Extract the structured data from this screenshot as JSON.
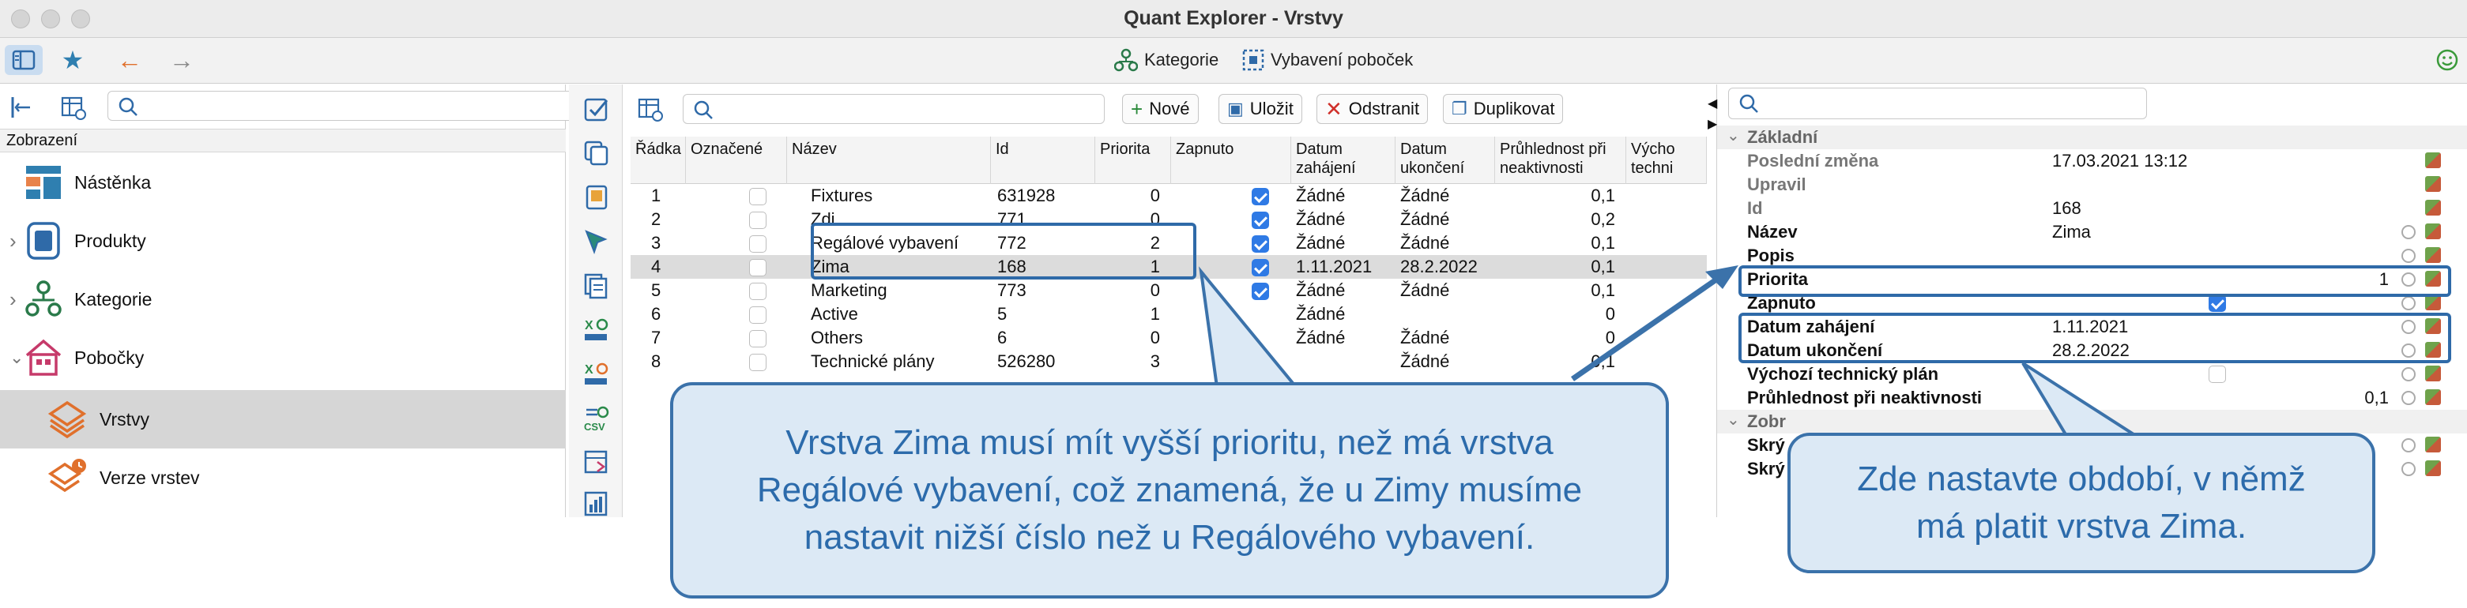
{
  "window": {
    "title": "Quant Explorer - Vrstvy"
  },
  "toolbar": {
    "categories_label": "Kategorie",
    "branch_equipment_label": "Vybavení poboček"
  },
  "left_panel": {
    "section_label": "Zobrazení",
    "items": [
      {
        "label": "Nástěnka"
      },
      {
        "label": "Produkty"
      },
      {
        "label": "Kategorie"
      },
      {
        "label": "Pobočky"
      },
      {
        "label": "Vrstvy"
      },
      {
        "label": "Verze vrstev"
      }
    ]
  },
  "actions": {
    "new": "Nové",
    "save": "Uložit",
    "delete": "Odstranit",
    "duplicate": "Duplikovat"
  },
  "table": {
    "columns": [
      "Řádka",
      "Označené",
      "Název",
      "Id",
      "Priorita",
      "Zapnuto",
      "Datum zahájení",
      "Datum ukončení",
      "Průhlednost při neaktivnosti",
      "Výcho techni"
    ],
    "rows": [
      {
        "row": "1",
        "name": "Fixtures",
        "id": "631928",
        "priority": "0",
        "start": "Žádné",
        "end": "Žádné",
        "transparency": "0,1"
      },
      {
        "row": "2",
        "name": "Zdi",
        "id": "771",
        "priority": "0",
        "start": "Žádné",
        "end": "Žádné",
        "transparency": "0,2"
      },
      {
        "row": "3",
        "name": "Regálové vybavení",
        "id": "772",
        "priority": "2",
        "start": "Žádné",
        "end": "Žádné",
        "transparency": "0,1"
      },
      {
        "row": "4",
        "name": "Zima",
        "id": "168",
        "priority": "1",
        "start": "1.11.2021",
        "end": "28.2.2022",
        "transparency": "0,1"
      },
      {
        "row": "5",
        "name": "Marketing",
        "id": "773",
        "priority": "0",
        "start": "Žádné",
        "end": "Žádné",
        "transparency": "0,1"
      },
      {
        "row": "6",
        "name": "Active",
        "id": "5",
        "priority": "1",
        "start": "Žádné",
        "end": "",
        "transparency": "0"
      },
      {
        "row": "7",
        "name": "Others",
        "id": "6",
        "priority": "0",
        "start": "Žádné",
        "end": "Žádné",
        "transparency": "0"
      },
      {
        "row": "8",
        "name": "Technické plány",
        "id": "526280",
        "priority": "3",
        "start": "",
        "end": "Žádné",
        "transparency": "0,1"
      }
    ]
  },
  "properties": {
    "group_basic": "Základní",
    "group_display": "Zobr",
    "rows": [
      {
        "key": "Poslední změna",
        "value": "17.03.2021 13:12",
        "bold": false
      },
      {
        "key": "Upravil",
        "value": "",
        "bold": false
      },
      {
        "key": "Id",
        "value": "168",
        "bold": false
      },
      {
        "key": "Název",
        "value": "Zima",
        "bold": true
      },
      {
        "key": "Popis",
        "value": "",
        "bold": true
      },
      {
        "key": "Priorita",
        "value": "1",
        "bold": true
      },
      {
        "key": "Zapnuto",
        "value": "",
        "bold": true
      },
      {
        "key": "Datum zahájení",
        "value": "1.11.2021",
        "bold": true
      },
      {
        "key": "Datum ukončení",
        "value": "28.2.2022",
        "bold": true
      },
      {
        "key": "Výchozí technický plán",
        "value": "",
        "bold": true
      },
      {
        "key": "Průhlednost při neaktivnosti",
        "value": "0,1",
        "bold": true
      }
    ],
    "extra_rows": [
      {
        "key": "Skrý"
      },
      {
        "key": "Skrý"
      }
    ]
  },
  "callouts": {
    "priority_note": [
      "Vrstva Zima musí mít vyšší prioritu, než má vrstva",
      "Regálové vybavení, což znamená, že u Zimy musíme",
      "nastavit nižší číslo než u Regálového vybavení."
    ],
    "period_note": [
      "Zde nastavte období, v němž",
      "má platit vrstva Zima."
    ]
  },
  "colors": {
    "accent": "#2f6aa8",
    "callout_bg": "#dce9f5",
    "callout_text": "#2c6bab",
    "checkbox_on": "#2f7ae5"
  }
}
